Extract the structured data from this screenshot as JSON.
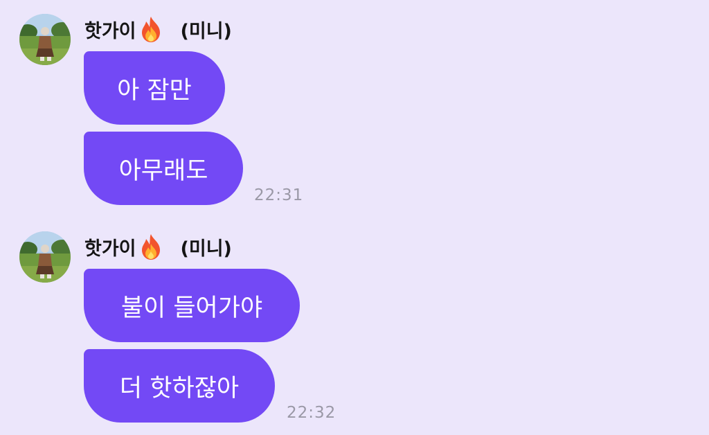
{
  "messages": [
    {
      "sender": "핫가이",
      "sender_tag": "(미니)",
      "bubbles": [
        "아 잠만",
        "아무래도"
      ],
      "time": "22:31"
    },
    {
      "sender": "핫가이",
      "sender_tag": "(미니)",
      "bubbles": [
        "불이 들어가야",
        "더 핫하잖아"
      ],
      "time": "22:32"
    }
  ],
  "icons": {
    "avatar": "profile-photo-person-in-park",
    "fire": "fire-emoji"
  },
  "colors": {
    "background": "#ece6fb",
    "bubble": "#7349f5",
    "bubble_text": "#ffffff",
    "time": "#9a98a6"
  }
}
